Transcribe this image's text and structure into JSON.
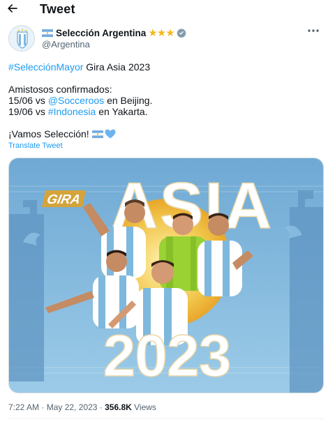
{
  "header": {
    "title": "Tweet",
    "back_icon": "arrow-left-icon"
  },
  "author": {
    "display_name": "Selección Argentina",
    "handle": "@Argentina",
    "stars": "★★★",
    "verified_icon": "verified-badge-icon",
    "more_icon": "more-horizontal-icon"
  },
  "tweet": {
    "hashtag_main": "#SelecciónMayor",
    "line1_rest": " Gira Asia 2023",
    "line2": "Amistosos confirmados:",
    "line3_date": "15/06 vs ",
    "line3_mention": "@Socceroos",
    "line3_rest": " en Beijing.",
    "line4_date": "19/06 vs ",
    "line4_hashtag": "#Indonesia",
    "line4_rest": " en Yakarta.",
    "line5": "¡Vamos Selección! ",
    "translate_label": "Translate Tweet"
  },
  "media": {
    "badge": "GIRA",
    "title": "ASIA",
    "year": "2023",
    "colors": {
      "sky": "#7fb8dd",
      "gold": "#f1c54a",
      "orange": "#e8862a",
      "white": "#ffffff",
      "heart": "#6cb4ee"
    }
  },
  "meta": {
    "time": "7:22 AM",
    "sep1": " · ",
    "date": "May 22, 2023",
    "sep2": " · ",
    "views_count": "356.8K",
    "views_label": " Views"
  }
}
